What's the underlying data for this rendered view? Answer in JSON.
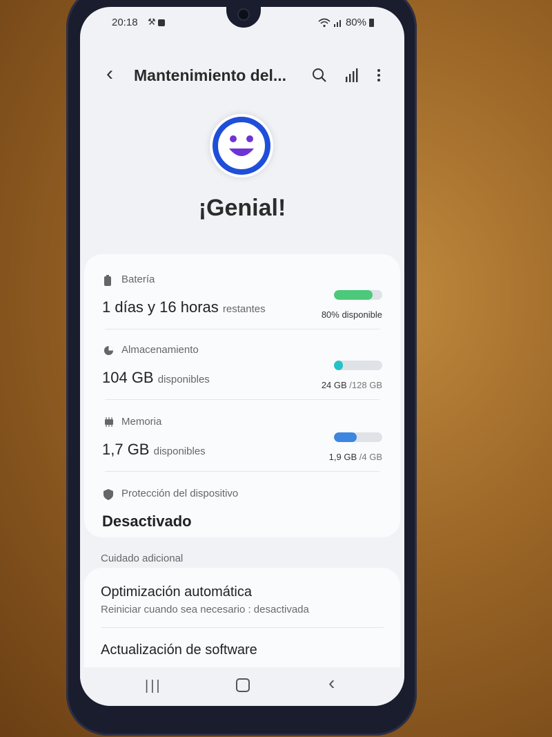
{
  "status_bar": {
    "time": "20:18",
    "battery_text": "80%"
  },
  "appbar": {
    "title": "Mantenimiento del...",
    "icons": [
      "back-icon",
      "search-icon",
      "signal-bars-icon",
      "more-vert-icon"
    ]
  },
  "hero": {
    "headline": "¡Genial!",
    "icon": "smiley-face-icon",
    "accent_color": "#1f4fd8"
  },
  "items": {
    "battery": {
      "label": "Batería",
      "value": "1 días y 16 horas",
      "unit": "restantes",
      "bar_fraction": 0.8,
      "bar_color": "#4cc97a",
      "bar_text": "80% disponible"
    },
    "storage": {
      "label": "Almacenamiento",
      "value": "104 GB",
      "unit": "disponibles",
      "bar_fraction": 0.19,
      "bar_color": "#25c2c7",
      "bar_used": "24 GB",
      "bar_total": "/128 GB"
    },
    "memory": {
      "label": "Memoria",
      "value": "1,7 GB",
      "unit": "disponibles",
      "bar_fraction": 0.475,
      "bar_color": "#3d86e0",
      "bar_used": "1,9 GB",
      "bar_total": "/4 GB"
    },
    "protection": {
      "label": "Protección del dispositivo",
      "value": "Desactivado"
    }
  },
  "additional_care": {
    "section_label": "Cuidado adicional",
    "auto_optimization": {
      "title": "Optimización automática",
      "subtitle": "Reiniciar cuando sea necesario : desactivada"
    },
    "software_update": {
      "title": "Actualización de software"
    }
  }
}
